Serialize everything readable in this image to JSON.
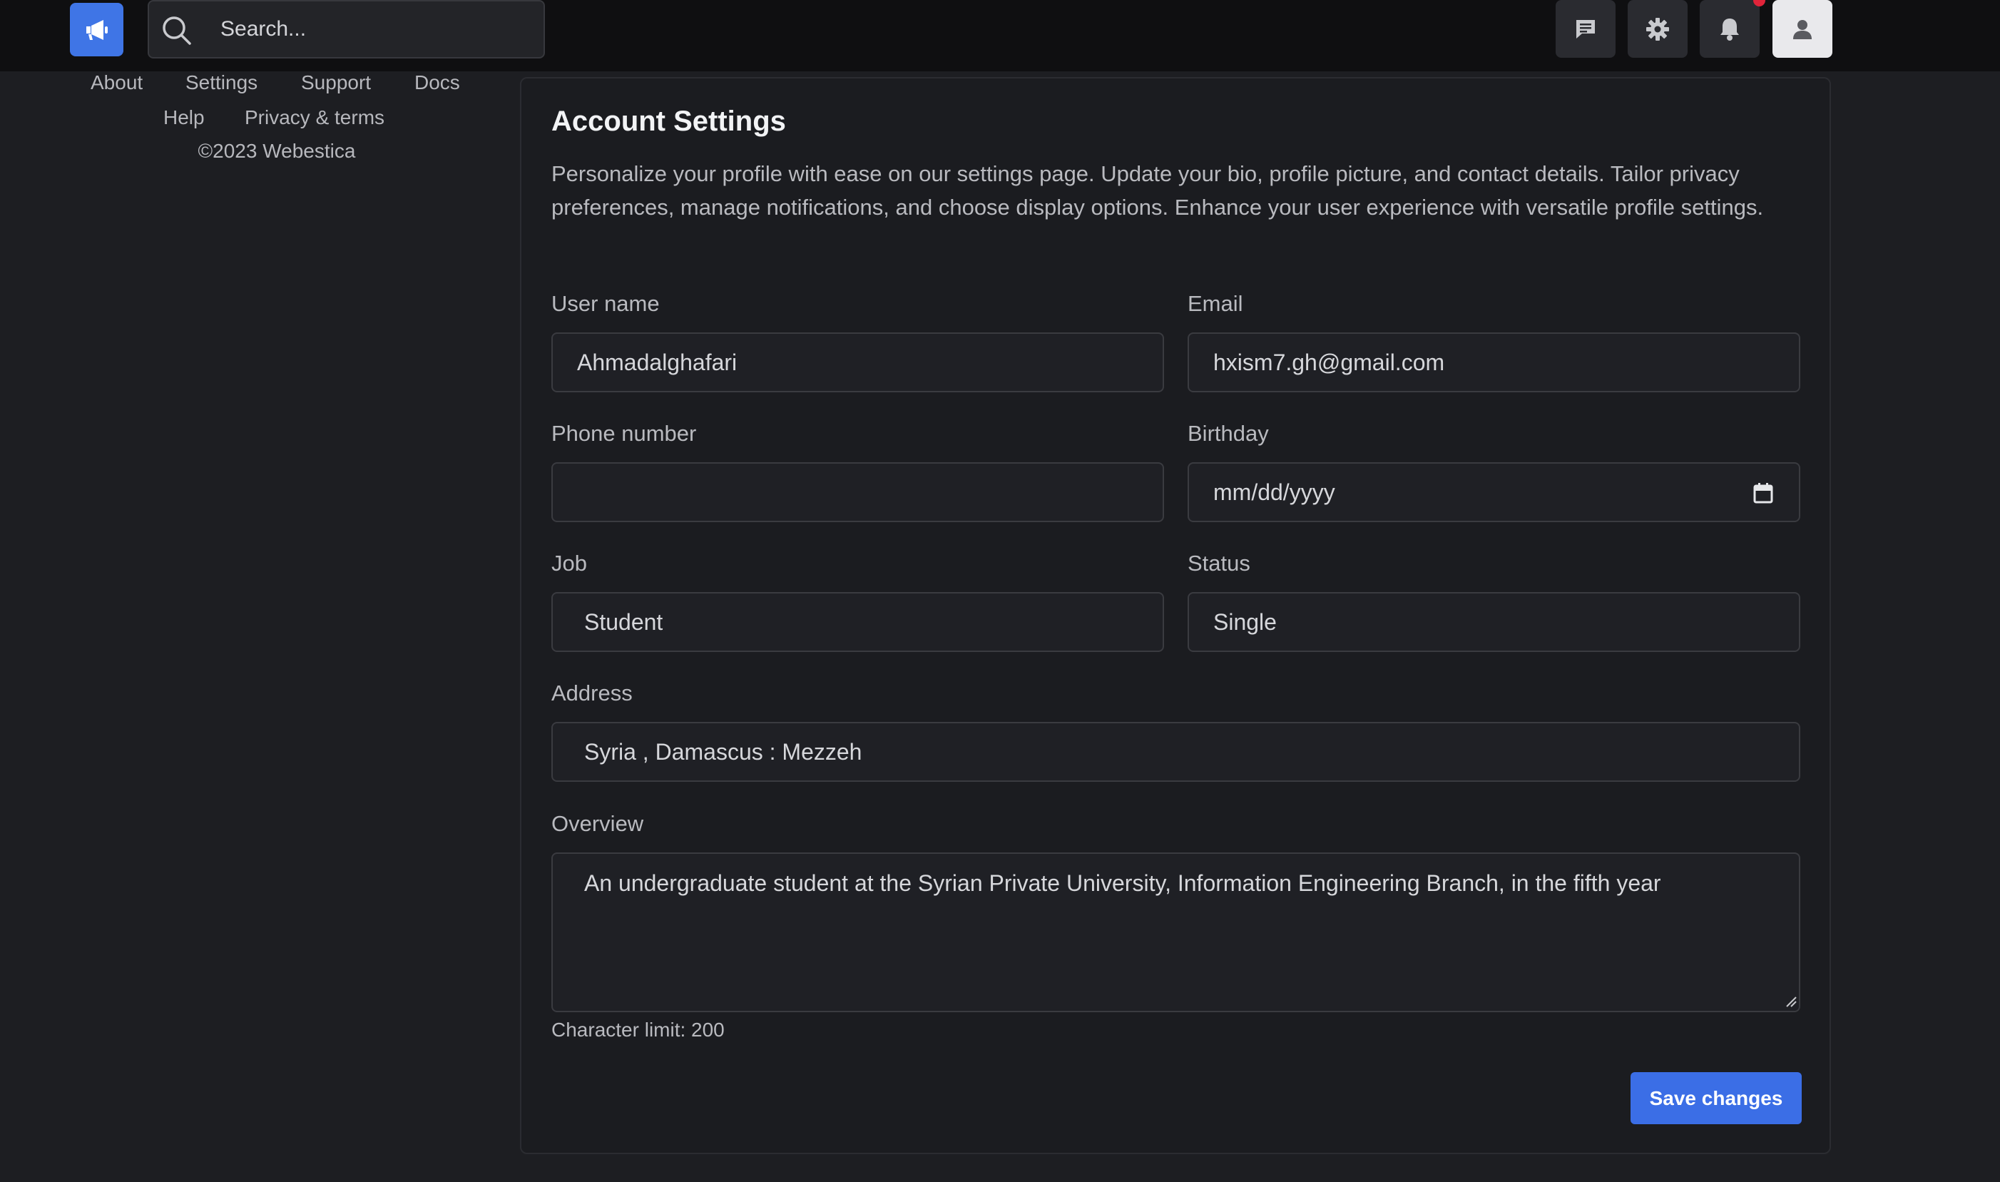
{
  "search": {
    "placeholder": "Search..."
  },
  "topbar": {
    "icons": [
      "megaphone-icon",
      "chat-icon",
      "gear-icon",
      "bell-icon",
      "user-icon"
    ],
    "accent": "#3f75e6",
    "notification_dot_color": "#e0243a"
  },
  "footer": {
    "links": [
      "About",
      "Settings",
      "Support",
      "Docs",
      "Help",
      "Privacy & terms"
    ],
    "copyright": "©2023 Webestica"
  },
  "form": {
    "title": "Account Settings",
    "description": "Personalize your profile with ease on our settings page. Update your bio, profile picture, and contact details. Tailor privacy preferences, manage notifications, and choose display options. Enhance your user experience with versatile profile settings.",
    "username": {
      "label": "User name",
      "value": "Ahmadalghafari"
    },
    "email": {
      "label": "Email",
      "value": "hxism7.gh@gmail.com"
    },
    "phone": {
      "label": "Phone number",
      "value": ""
    },
    "birthday": {
      "label": "Birthday",
      "placeholder": "mm/dd/yyyy"
    },
    "job": {
      "label": "Job",
      "value": "Student"
    },
    "status": {
      "label": "Status",
      "value": "Single"
    },
    "address": {
      "label": "Address",
      "value": "Syria , Damascus : Mezzeh"
    },
    "overview": {
      "label": "Overview",
      "value": "An undergraduate student at the Syrian Private University, Information Engineering Branch, in the fifth year"
    },
    "character_limit": "Character limit: 200",
    "save_label": "Save changes"
  }
}
